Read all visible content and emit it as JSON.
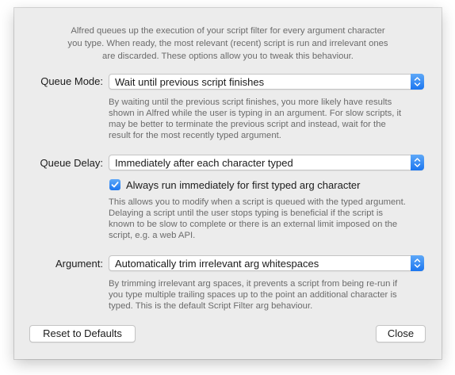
{
  "intro": {
    "line1": "Alfred queues up the execution of your script filter for every argument character",
    "line2": "you type. When ready, the most relevant (recent) script is run and irrelevant ones",
    "line3": "are discarded. These options allow you to tweak this behaviour."
  },
  "queue_mode": {
    "label": "Queue Mode:",
    "value": "Wait until previous script finishes",
    "desc": [
      "By waiting until the previous script finishes, you more likely have results",
      "shown in Alfred while the user is typing in an argument. For slow scripts, it",
      "may be better to terminate the previous script and instead, wait for the",
      "result for the most recently typed argument."
    ]
  },
  "queue_delay": {
    "label": "Queue Delay:",
    "value": "Immediately after each character typed",
    "checkbox_label": "Always run immediately for first typed arg character",
    "checkbox_checked": true,
    "desc": [
      "This allows you to modify when a script is queued with the typed argument.",
      "Delaying a script until the user stops typing is beneficial if the script is",
      "known to be slow to complete or there is an external limit imposed on the",
      "script, e.g. a web API."
    ]
  },
  "argument": {
    "label": "Argument:",
    "value": "Automatically trim irrelevant arg whitespaces",
    "desc": [
      "By trimming irrelevant arg spaces, it prevents a script from being re-run if",
      "you type multiple trailing spaces up to the point an additional character is",
      "typed. This is the default Script Filter arg behaviour."
    ]
  },
  "buttons": {
    "reset": "Reset to Defaults",
    "close": "Close"
  },
  "colors": {
    "accent": "#1b76f0"
  }
}
